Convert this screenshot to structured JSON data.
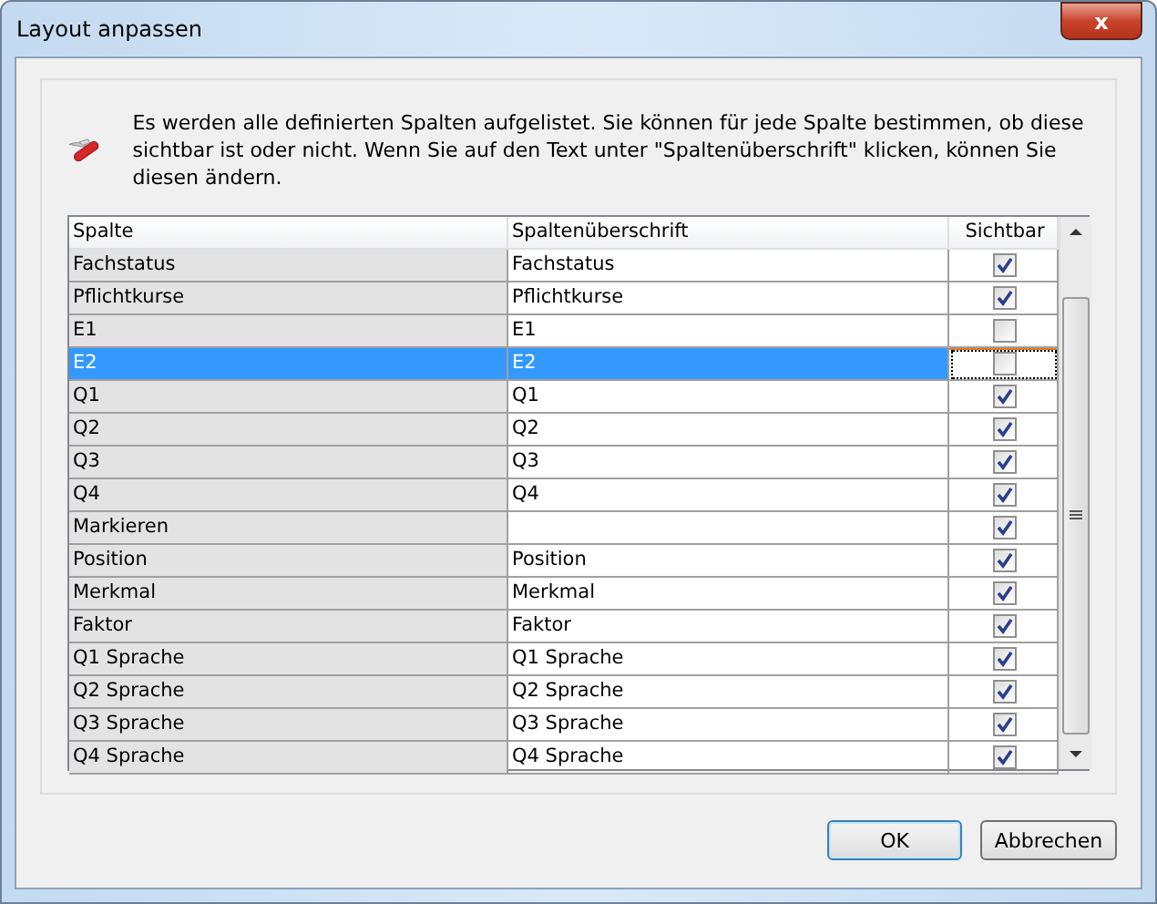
{
  "window": {
    "title": "Layout anpassen",
    "close_label": "x"
  },
  "description": "Es werden alle definierten Spalten aufgelistet. Sie können für jede Spalte bestimmen, ob diese sichtbar ist oder nicht. Wenn Sie auf den Text unter \"Spaltenüberschrift\" klicken, können Sie diesen ändern.",
  "table": {
    "columns": [
      "Spalte",
      "Spaltenüberschrift",
      "Sichtbar"
    ],
    "rows": [
      {
        "column": "Fachstatus",
        "heading": "Fachstatus",
        "visible": true,
        "selected": false
      },
      {
        "column": "Pflichtkurse",
        "heading": "Pflichtkurse",
        "visible": true,
        "selected": false
      },
      {
        "column": "E1",
        "heading": "E1",
        "visible": false,
        "selected": false
      },
      {
        "column": "E2",
        "heading": "E2",
        "visible": false,
        "selected": true
      },
      {
        "column": "Q1",
        "heading": "Q1",
        "visible": true,
        "selected": false
      },
      {
        "column": "Q2",
        "heading": "Q2",
        "visible": true,
        "selected": false
      },
      {
        "column": "Q3",
        "heading": "Q3",
        "visible": true,
        "selected": false
      },
      {
        "column": "Q4",
        "heading": "Q4",
        "visible": true,
        "selected": false
      },
      {
        "column": "Markieren",
        "visible": true,
        "selected": false
      },
      {
        "column": "Position",
        "heading": "Position",
        "visible": true,
        "selected": false
      },
      {
        "column": "Merkmal",
        "heading": "Merkmal",
        "visible": true,
        "selected": false
      },
      {
        "column": "Faktor",
        "heading": "Faktor",
        "visible": true,
        "selected": false
      },
      {
        "column": "Q1 Sprache",
        "heading": "Q1 Sprache",
        "visible": true,
        "selected": false
      },
      {
        "column": "Q2 Sprache",
        "heading": "Q2 Sprache",
        "visible": true,
        "selected": false
      },
      {
        "column": "Q3 Sprache",
        "heading": "Q3 Sprache",
        "visible": true,
        "selected": false
      },
      {
        "column": "Q4 Sprache",
        "heading": "Q4 Sprache",
        "visible": true,
        "selected": false
      }
    ]
  },
  "buttons": [
    {
      "label": "OK",
      "default": true
    },
    {
      "label": "Abbrechen",
      "default": false
    }
  ]
}
